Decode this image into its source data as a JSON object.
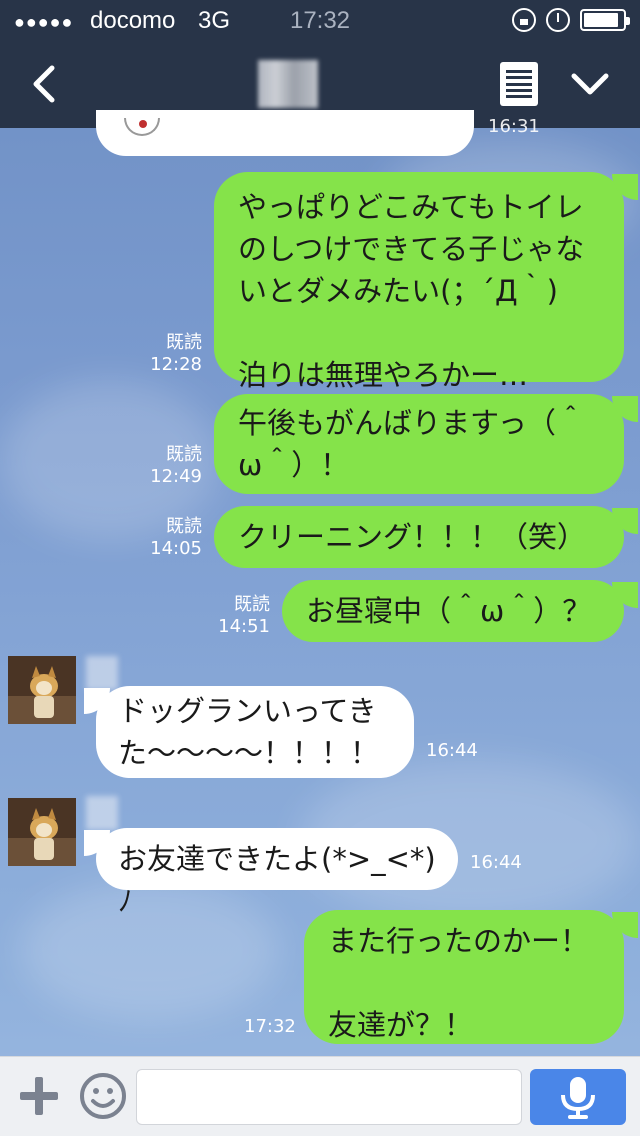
{
  "status_bar": {
    "signal": "●●●●●",
    "carrier": "docomo",
    "network": "3G",
    "time": "17:32"
  },
  "nav": {
    "back_icon": "chevron-left-icon",
    "menu_icon": "list-icon",
    "expand_icon": "chevron-down-icon"
  },
  "top_partial": {
    "time": "16:31"
  },
  "messages": [
    {
      "side": "right",
      "text": "やっぱりどこみてもトイレ\nのしつけできてる子じゃな\nいとダメみたい(；´Д｀)\n\n泊りは無理やろかー…",
      "read": "既読",
      "time": "12:28"
    },
    {
      "side": "right",
      "text": "午後もがんばりますっ（＾\nω＾）！",
      "read": "既読",
      "time": "12:49"
    },
    {
      "side": "right",
      "text": "クリーニング！！！（笑）",
      "read": "既読",
      "time": "14:05"
    },
    {
      "side": "right",
      "text": "お昼寝中（＾ω＾）？",
      "read": "既読",
      "time": "14:51"
    },
    {
      "side": "left",
      "text": "ドッグランいってき\nた〜〜〜〜！！！！",
      "time": "16:44"
    },
    {
      "side": "left",
      "text": "お友達できたよ(*>_<*)ﾉ",
      "time": "16:44"
    },
    {
      "side": "right",
      "text": "また行ったのかー！\n\n友達が？！",
      "time": "17:32"
    }
  ],
  "input": {
    "placeholder": "",
    "plus_icon": "plus-icon",
    "emoji_icon": "smiley-icon",
    "mic_icon": "microphone-icon"
  },
  "colors": {
    "header": "#283448",
    "my_bubble": "#85e34a",
    "their_bubble": "#ffffff",
    "mic_button": "#4a86e8"
  }
}
